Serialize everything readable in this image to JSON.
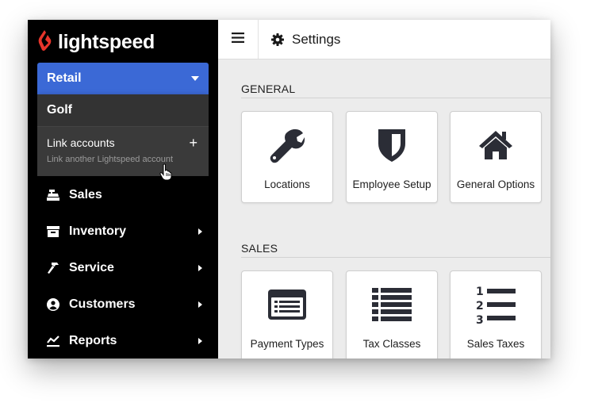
{
  "logo": {
    "text": "lightspeed",
    "icon": "flame-icon"
  },
  "account_switcher": {
    "selected": "Retail",
    "options": [
      "Golf"
    ],
    "link_accounts": {
      "title": "Link accounts",
      "subtitle": "Link another Lightspeed account",
      "icon": "plus-icon"
    }
  },
  "nav": {
    "items": [
      {
        "label": "Sales",
        "icon": "register-icon",
        "has_submenu": false
      },
      {
        "label": "Inventory",
        "icon": "box-icon",
        "has_submenu": true
      },
      {
        "label": "Service",
        "icon": "hammer-icon",
        "has_submenu": true
      },
      {
        "label": "Customers",
        "icon": "user-circle-icon",
        "has_submenu": true
      },
      {
        "label": "Reports",
        "icon": "chart-line-icon",
        "has_submenu": true
      }
    ]
  },
  "header": {
    "title": "Settings",
    "icon": "gear-icon",
    "menu_icon": "hamburger-icon"
  },
  "sections": {
    "general": {
      "title": "GENERAL",
      "tiles": [
        {
          "label": "Locations",
          "icon": "wrench-icon"
        },
        {
          "label": "Employee Setup",
          "icon": "shield-icon"
        },
        {
          "label": "General Options",
          "icon": "house-icon"
        }
      ]
    },
    "sales": {
      "title": "SALES",
      "tiles": [
        {
          "label": "Payment Types",
          "icon": "credit-card-icon"
        },
        {
          "label": "Tax Classes",
          "icon": "list-icon"
        },
        {
          "label": "Sales Taxes",
          "icon": "numbered-list-icon"
        }
      ]
    }
  },
  "colors": {
    "accent": "#3b69d6",
    "sidebar": "#000000",
    "logo_flame": "#e8352b",
    "icon": "#2b2d36"
  }
}
